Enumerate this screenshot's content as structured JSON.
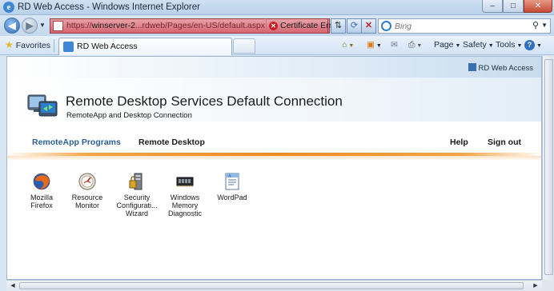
{
  "window": {
    "title": "RD Web Access - Windows Internet Explorer",
    "controls": {
      "minimize": "–",
      "maximize": "□",
      "close": "✕"
    }
  },
  "address_bar": {
    "url_prefix": "https://",
    "url_host": "winserver-2",
    "url_rest": "...rdweb/Pages/en-US/default.aspx",
    "certificate_error": "Certificate Error",
    "accent": "#d56670"
  },
  "search": {
    "placeholder": "Bing"
  },
  "favorites": {
    "label": "Favorites"
  },
  "tab": {
    "label": "RD Web Access"
  },
  "command_bar": {
    "page": "Page",
    "safety": "Safety",
    "tools": "Tools",
    "help": "?"
  },
  "rd": {
    "brand": "RD Web Access",
    "title": "Remote Desktop Services Default Connection",
    "subtitle": "RemoteApp and Desktop Connection",
    "nav": {
      "remoteapp": "RemoteApp Programs",
      "remote_desktop": "Remote Desktop",
      "help": "Help",
      "sign_out": "Sign out"
    },
    "apps": [
      {
        "line1": "Mozilla",
        "line2": "Firefox",
        "line3": "",
        "icon": "firefox-icon"
      },
      {
        "line1": "Resource",
        "line2": "Monitor",
        "line3": "",
        "icon": "resource-monitor-icon"
      },
      {
        "line1": "Security",
        "line2": "Configurati...",
        "line3": "Wizard",
        "icon": "security-wizard-icon"
      },
      {
        "line1": "Windows",
        "line2": "Memory",
        "line3": "Diagnostic",
        "icon": "memory-diagnostic-icon"
      },
      {
        "line1": "WordPad",
        "line2": "",
        "line3": "",
        "icon": "wordpad-icon"
      }
    ],
    "accent_orange": "#e98b23",
    "accent_blue": "#2e5e97"
  }
}
